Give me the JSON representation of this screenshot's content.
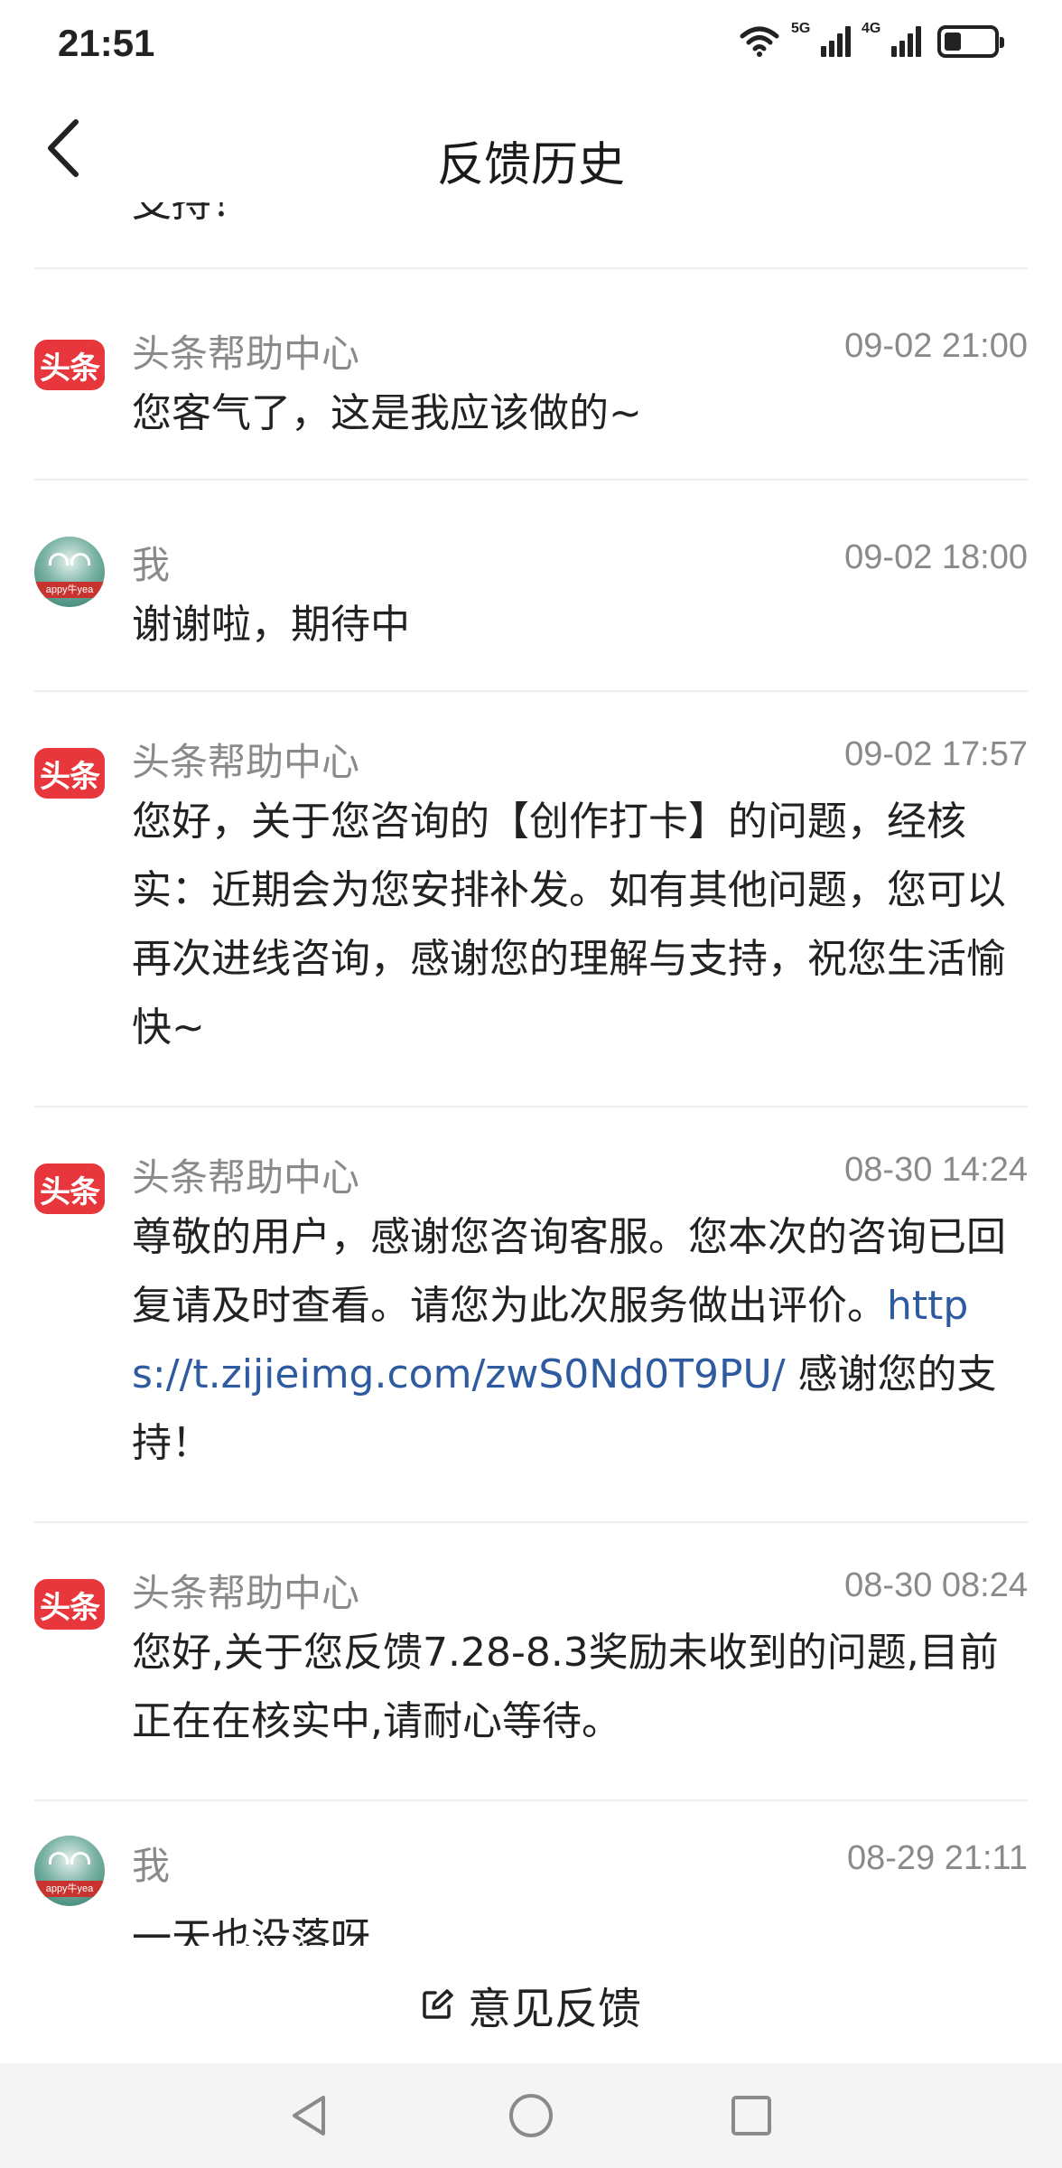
{
  "status_bar": {
    "time": "21:51",
    "wifi_icon": "wifi-icon",
    "signal_1_label": "5G",
    "signal_2_label": "4G",
    "battery_icon": "battery-icon",
    "battery_level": 0.35
  },
  "header": {
    "title": "反馈历史",
    "back_icon": "chevron-left-icon"
  },
  "list": {
    "clipped_top_text": "支持！",
    "messages": [
      {
        "sender": "头条帮助中心",
        "avatar": "toutiao-logo",
        "avatar_text": "头条",
        "time": "09-02 21:00",
        "body": "您客气了，这是我应该做的~"
      },
      {
        "sender": "我",
        "avatar": "user-avatar",
        "avatar_text": "appy牛yea",
        "time": "09-02 18:00",
        "body": "谢谢啦，期待中"
      },
      {
        "sender": "头条帮助中心",
        "avatar": "toutiao-logo",
        "avatar_text": "头条",
        "time": "09-02 17:57",
        "body": "您好，关于您咨询的【创作打卡】的问题，经核实：近期会为您安排补发。如有其他问题，您可以再次进线咨询，感谢您的理解与支持，祝您生活愉快~"
      },
      {
        "sender": "头条帮助中心",
        "avatar": "toutiao-logo",
        "avatar_text": "头条",
        "time": "08-30 14:24",
        "body_pre": "尊敬的用户，感谢您咨询客服。您本次的咨询已回复请及时查看。请您为此次服务做出评价。",
        "body_link": "https://t.zijieimg.com/zwS0Nd0T9PU/",
        "body_post": " 感谢您的支持！"
      },
      {
        "sender": "头条帮助中心",
        "avatar": "toutiao-logo",
        "avatar_text": "头条",
        "time": "08-30 08:24",
        "body": "您好,关于您反馈7.28-8.3奖励未收到的问题,目前正在在核实中,请耐心等待。"
      },
      {
        "sender": "我",
        "avatar": "user-avatar",
        "avatar_text": "appy牛yea",
        "time": "08-29 21:11",
        "body": "一天也没落呀"
      }
    ]
  },
  "feedback_bar": {
    "label": "意见反馈",
    "icon": "edit-icon"
  },
  "nav_bar": {
    "back_icon": "triangle-back-icon",
    "home_icon": "circle-home-icon",
    "recents_icon": "square-recents-icon"
  }
}
